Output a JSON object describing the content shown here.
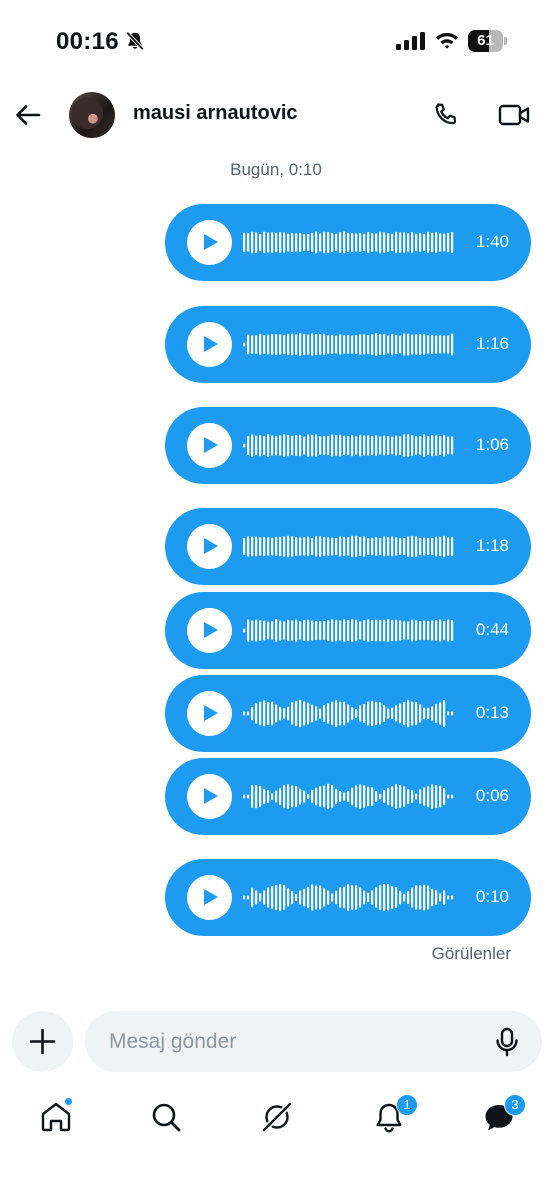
{
  "status_bar": {
    "time": "00:16",
    "battery_level": "61",
    "battery_fraction": 0.61
  },
  "header": {
    "contact_name": "mausi arnautovic"
  },
  "conversation": {
    "date_label": "Bugün, 0:10",
    "seen_label": "Görülenler",
    "voice_messages": [
      {
        "duration": "1:40"
      },
      {
        "duration": "1:16"
      },
      {
        "duration": "1:06"
      },
      {
        "duration": "1:18"
      },
      {
        "duration": "0:44"
      },
      {
        "duration": "0:13"
      },
      {
        "duration": "0:06"
      },
      {
        "duration": "0:10"
      }
    ]
  },
  "composer": {
    "placeholder": "Mesaj gönder"
  },
  "bottom_nav": {
    "notifications_count": "1",
    "messages_count": "3",
    "icons": [
      "home-icon",
      "search-icon",
      "grok-icon",
      "notifications-icon",
      "messages-icon"
    ]
  },
  "colors": {
    "accent": "#1d9bf0",
    "text": "#0f1419",
    "secondary_text": "#536471",
    "input_background": "#eff3f4"
  }
}
